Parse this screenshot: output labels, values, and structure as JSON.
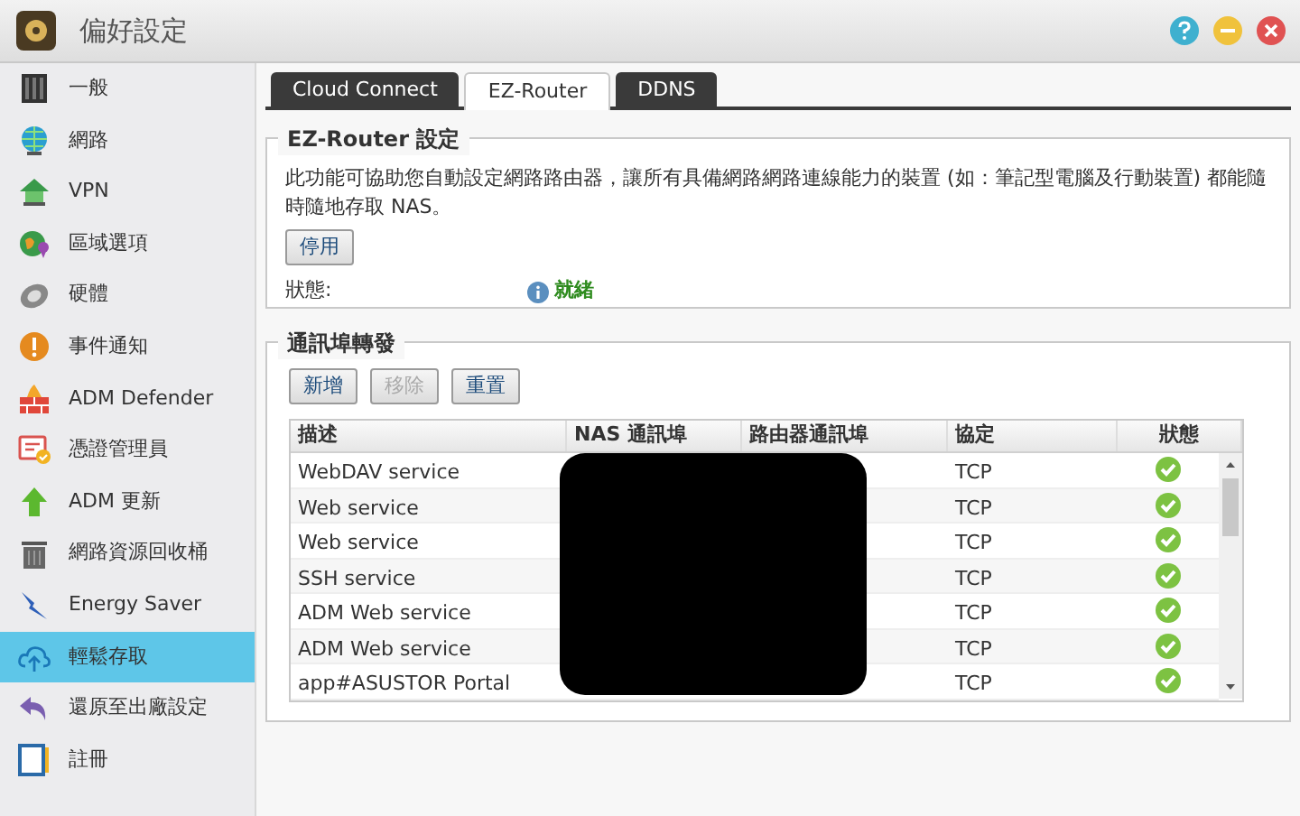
{
  "window": {
    "title": "偏好設定"
  },
  "sidebar": {
    "items": [
      {
        "label": "一般",
        "selected": false
      },
      {
        "label": "網路",
        "selected": false
      },
      {
        "label": "VPN",
        "selected": false
      },
      {
        "label": "區域選項",
        "selected": false
      },
      {
        "label": "硬體",
        "selected": false
      },
      {
        "label": "事件通知",
        "selected": false
      },
      {
        "label": "ADM Defender",
        "selected": false
      },
      {
        "label": "憑證管理員",
        "selected": false
      },
      {
        "label": "ADM 更新",
        "selected": false
      },
      {
        "label": "網路資源回收桶",
        "selected": false
      },
      {
        "label": "Energy Saver",
        "selected": false
      },
      {
        "label": "輕鬆存取",
        "selected": true
      },
      {
        "label": "還原至出廠設定",
        "selected": false
      },
      {
        "label": "註冊",
        "selected": false
      }
    ]
  },
  "tabs": [
    {
      "label": "Cloud Connect",
      "selected": false
    },
    {
      "label": "EZ-Router",
      "selected": true
    },
    {
      "label": "DDNS",
      "selected": false
    }
  ],
  "ez_router": {
    "legend": "EZ-Router 設定",
    "description": "此功能可協助您自動設定網路路由器，讓所有具備網路網路連線能力的裝置 (如：筆記型電腦及行動裝置) 都能隨時隨地存取 NAS。",
    "button": "停用",
    "status_label": "狀態:",
    "status_value": "就緒"
  },
  "port_forwarding": {
    "legend": "通訊埠轉發",
    "buttons": [
      {
        "label": "新增",
        "disabled": false
      },
      {
        "label": "移除",
        "disabled": true
      },
      {
        "label": "重置",
        "disabled": false
      }
    ],
    "table": {
      "columns": [
        "描述",
        "NAS 通訊埠",
        "路由器通訊埠",
        "協定",
        "狀態"
      ],
      "rows": [
        {
          "description": "WebDAV service",
          "protocol": "TCP",
          "ok": true
        },
        {
          "description": "Web service",
          "protocol": "TCP",
          "ok": true
        },
        {
          "description": "Web service",
          "protocol": "TCP",
          "ok": true
        },
        {
          "description": "SSH service",
          "protocol": "TCP",
          "ok": true
        },
        {
          "description": "ADM Web service",
          "protocol": "TCP",
          "ok": true
        },
        {
          "description": "ADM Web service",
          "protocol": "TCP",
          "ok": true
        },
        {
          "description": "app#ASUSTOR Portal",
          "protocol": "TCP",
          "ok": true
        }
      ]
    }
  }
}
